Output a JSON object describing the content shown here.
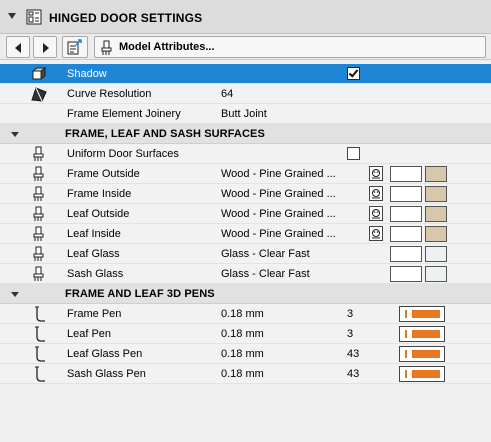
{
  "panel": {
    "title": "HINGED DOOR SETTINGS"
  },
  "toolbar": {
    "dropdown_label": "Model Attributes..."
  },
  "rows": {
    "shadow": {
      "label": "Shadow",
      "checked": true
    },
    "curve_resolution": {
      "label": "Curve Resolution",
      "value": "64"
    },
    "frame_element_joinery": {
      "label": "Frame Element Joinery",
      "value": "Butt Joint"
    }
  },
  "sections": {
    "surfaces": {
      "title": "FRAME, LEAF AND SASH SURFACES",
      "uniform": {
        "label": "Uniform Door Surfaces",
        "checked": false
      },
      "items": [
        {
          "label": "Frame Outside",
          "value": "Wood - Pine Grained ...",
          "swatch_color": "#d7c8ab"
        },
        {
          "label": "Frame Inside",
          "value": "Wood - Pine Grained ...",
          "swatch_color": "#d7c8ab"
        },
        {
          "label": "Leaf Outside",
          "value": "Wood - Pine Grained ...",
          "swatch_color": "#d7c8ab"
        },
        {
          "label": "Leaf Inside",
          "value": "Wood - Pine Grained ...",
          "swatch_color": "#d7c8ab"
        },
        {
          "label": "Leaf Glass",
          "value": "Glass - Clear Fast",
          "swatch_color": "#eef1f1"
        },
        {
          "label": "Sash Glass",
          "value": "Glass - Clear Fast",
          "swatch_color": "#eef1f1"
        }
      ]
    },
    "pens": {
      "title": "FRAME AND LEAF 3D PENS",
      "items": [
        {
          "label": "Frame Pen",
          "value": "0.18 mm",
          "pen_number": "3"
        },
        {
          "label": "Leaf Pen",
          "value": "0.18 mm",
          "pen_number": "3"
        },
        {
          "label": "Leaf Glass Pen",
          "value": "0.18 mm",
          "pen_number": "43"
        },
        {
          "label": "Sash Glass Pen",
          "value": "0.18 mm",
          "pen_number": "43"
        }
      ]
    }
  },
  "colors": {
    "selection": "#1f86d6",
    "pen_orange": "#e87722",
    "wood_swatch": "#d7c8ab",
    "glass_swatch": "#eef1f1"
  }
}
